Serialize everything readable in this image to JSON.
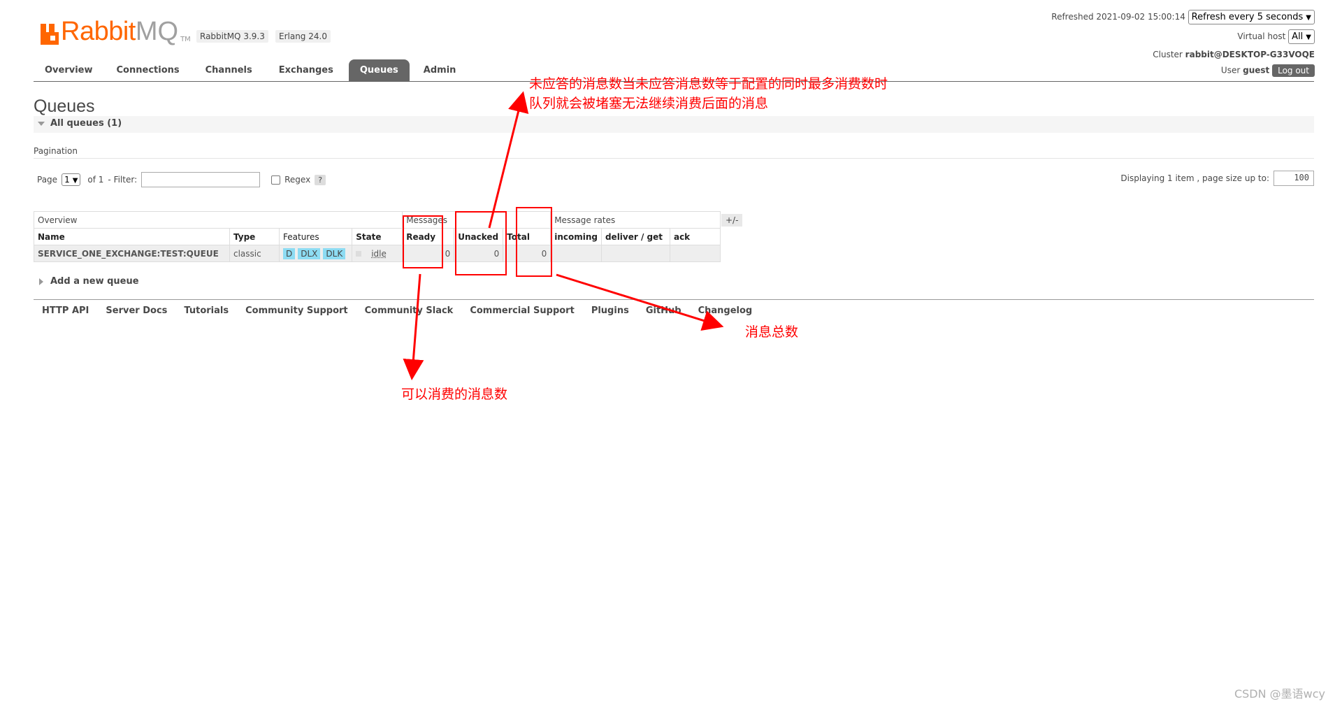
{
  "app": {
    "logo_rabbit": "Rabbit",
    "logo_mq": "MQ",
    "logo_tm": "TM",
    "version": "RabbitMQ 3.9.3",
    "erlang": "Erlang 24.0"
  },
  "status": {
    "refreshed": "Refreshed 2021-09-02 15:00:14",
    "refresh_select": "Refresh every 5 seconds",
    "vhost_label": "Virtual host",
    "vhost_select": "All",
    "cluster_label": "Cluster",
    "cluster_name": "rabbit@DESKTOP-G33VOQE",
    "user_label": "User",
    "user_name": "guest",
    "logout": "Log out"
  },
  "nav": {
    "items": [
      "Overview",
      "Connections",
      "Channels",
      "Exchanges",
      "Queues",
      "Admin"
    ],
    "active": "Queues"
  },
  "page": {
    "title": "Queues",
    "all_queues": "All queues (1)",
    "pagination_label": "Pagination",
    "page_label": "Page",
    "page_value": "1",
    "of_label": "of 1",
    "filter_label": "- Filter:",
    "regex_label": "Regex",
    "help": "?",
    "display_info": "Displaying 1 item , page size up to:",
    "page_size": "100"
  },
  "table": {
    "groups": [
      "Overview",
      "Messages",
      "Message rates"
    ],
    "plus_minus": "+/-",
    "columns": [
      "Name",
      "Type",
      "Features",
      "State",
      "Ready",
      "Unacked",
      "Total",
      "incoming",
      "deliver / get",
      "ack"
    ],
    "rows": [
      {
        "name": "SERVICE_ONE_EXCHANGE:TEST:QUEUE",
        "type": "classic",
        "features": [
          "D",
          "DLX",
          "DLK"
        ],
        "state": "idle",
        "ready": "0",
        "unacked": "0",
        "total": "0",
        "incoming": "",
        "deliver_get": "",
        "ack": ""
      }
    ]
  },
  "add_queue": "Add a new queue",
  "footer": [
    "HTTP API",
    "Server Docs",
    "Tutorials",
    "Community Support",
    "Community Slack",
    "Commercial Support",
    "Plugins",
    "GitHub",
    "Changelog"
  ],
  "annotations": {
    "unacked_line1": "未应答的消息数当未应答消息数等于配置的同时最多消费数时",
    "unacked_line2": "队列就会被堵塞无法继续消费后面的消息",
    "ready": "可以消费的消息数",
    "total": "消息总数",
    "color": "#ff0000"
  },
  "watermark": "CSDN @墨语wcy",
  "colors": {
    "brand": "#ff6600",
    "nav_active": "#666666",
    "feature_badge": "#8ddcf3"
  }
}
